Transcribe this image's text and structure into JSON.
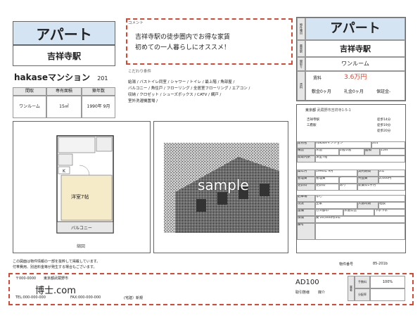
{
  "left_header": {
    "type": "アパート",
    "station": "吉祥寺駅"
  },
  "building": {
    "name": "hakaseマンション",
    "room": "201"
  },
  "summary_table": {
    "headers": [
      "間取",
      "専有面積",
      "築年数"
    ],
    "values": [
      "ワンルーム",
      "15㎡",
      "1990年 9月"
    ]
  },
  "comment": {
    "label": "コメント",
    "line1": "吉祥寺駅の徒歩圏内でお得な家賃",
    "line2": "初めての一人暮らしにオススメ！"
  },
  "conditions": {
    "label": "こだわり条件",
    "line1": "給湯 / バストイレ同室 / シャワー / トイレ / 最上階 / 角部屋 /",
    "line2": "バルコニー / 角住戸 / フローリング / 全居室フローリング / エアコン /",
    "line3": "収納 / クロゼット / シューズボックス / CATV / 網戸 /",
    "line4": "室外洗濯機置場 /"
  },
  "floorplan": {
    "room_label": "洋室7帖",
    "balcony_label": "バルコニー",
    "caption": "縮図",
    "k_label": "K"
  },
  "photo": {
    "watermark": "sample"
  },
  "right_header": {
    "side1": "物件種目",
    "side2": "最寄駅",
    "side3": "間取り",
    "side4": "賃料",
    "type": "アパート",
    "station": "吉祥寺駅",
    "layout": "ワンルーム",
    "rent_label": "賃料",
    "rent": "3.6万円",
    "deposit": "敷金0ヶ月",
    "key_money": "礼金0ヶ月",
    "guarantee": "保証金-"
  },
  "detail": {
    "address_pref": "東京都",
    "address_rest": "武蔵野市吉祥寺1-5-1",
    "access": [
      {
        "line": "吉祥寺駅",
        "walk": "徒歩14分"
      },
      {
        "line": "三鷹駅",
        "walk": "徒歩19分"
      },
      {
        "line": "",
        "walk": "徒歩20分"
      }
    ],
    "rows": [
      [
        "建物名",
        "hakaseマンション",
        "201"
      ],
      [
        "構造",
        "木造",
        "2階/2階",
        "面積",
        "15㎡"
      ],
      [
        "間取内訳",
        "洋室7帖"
      ],
      [
        "築年月",
        "1990年 9月",
        "契約期間",
        "2年"
      ],
      [
        "管理費",
        "管理費",
        "-",
        "共益費",
        "2,000円"
      ],
      [
        "更新料",
        "更新料",
        "あり",
        "新賃料1ヶ月"
      ],
      [
        "駐車場",
        "なし",
        "",
        "",
        "",
        ""
      ],
      [
        "現況",
        "空家",
        "入居時期",
        "相談"
      ],
      [
        "設備",
        "ガス都市",
        "水道公営",
        "下水下水"
      ],
      [
        "保険",
        "要 20,000円/2年"
      ],
      [
        "備考",
        "",
        ""
      ]
    ],
    "footer_left": "物件番号",
    "footer_right": "85-201b"
  },
  "notice": {
    "line1": "この図面は物件情報の一部を抜粋して掲載しています。",
    "line2": "付帯費用、別途料金等が発生する場合もございます。"
  },
  "footer": {
    "postal": "〒000-0000",
    "address": "東京都武蔵野市",
    "company": "博士.com",
    "tel": "TEL:000-000-000",
    "fax": "FAX:000-000-000",
    "license": "(宅建）新規",
    "code": "AD100",
    "deal_label": "取引態様",
    "deal_value": "媒介",
    "fee_label": "手数料",
    "fee_value": "100%",
    "share_label": "分配率",
    "side_label": "業者"
  }
}
